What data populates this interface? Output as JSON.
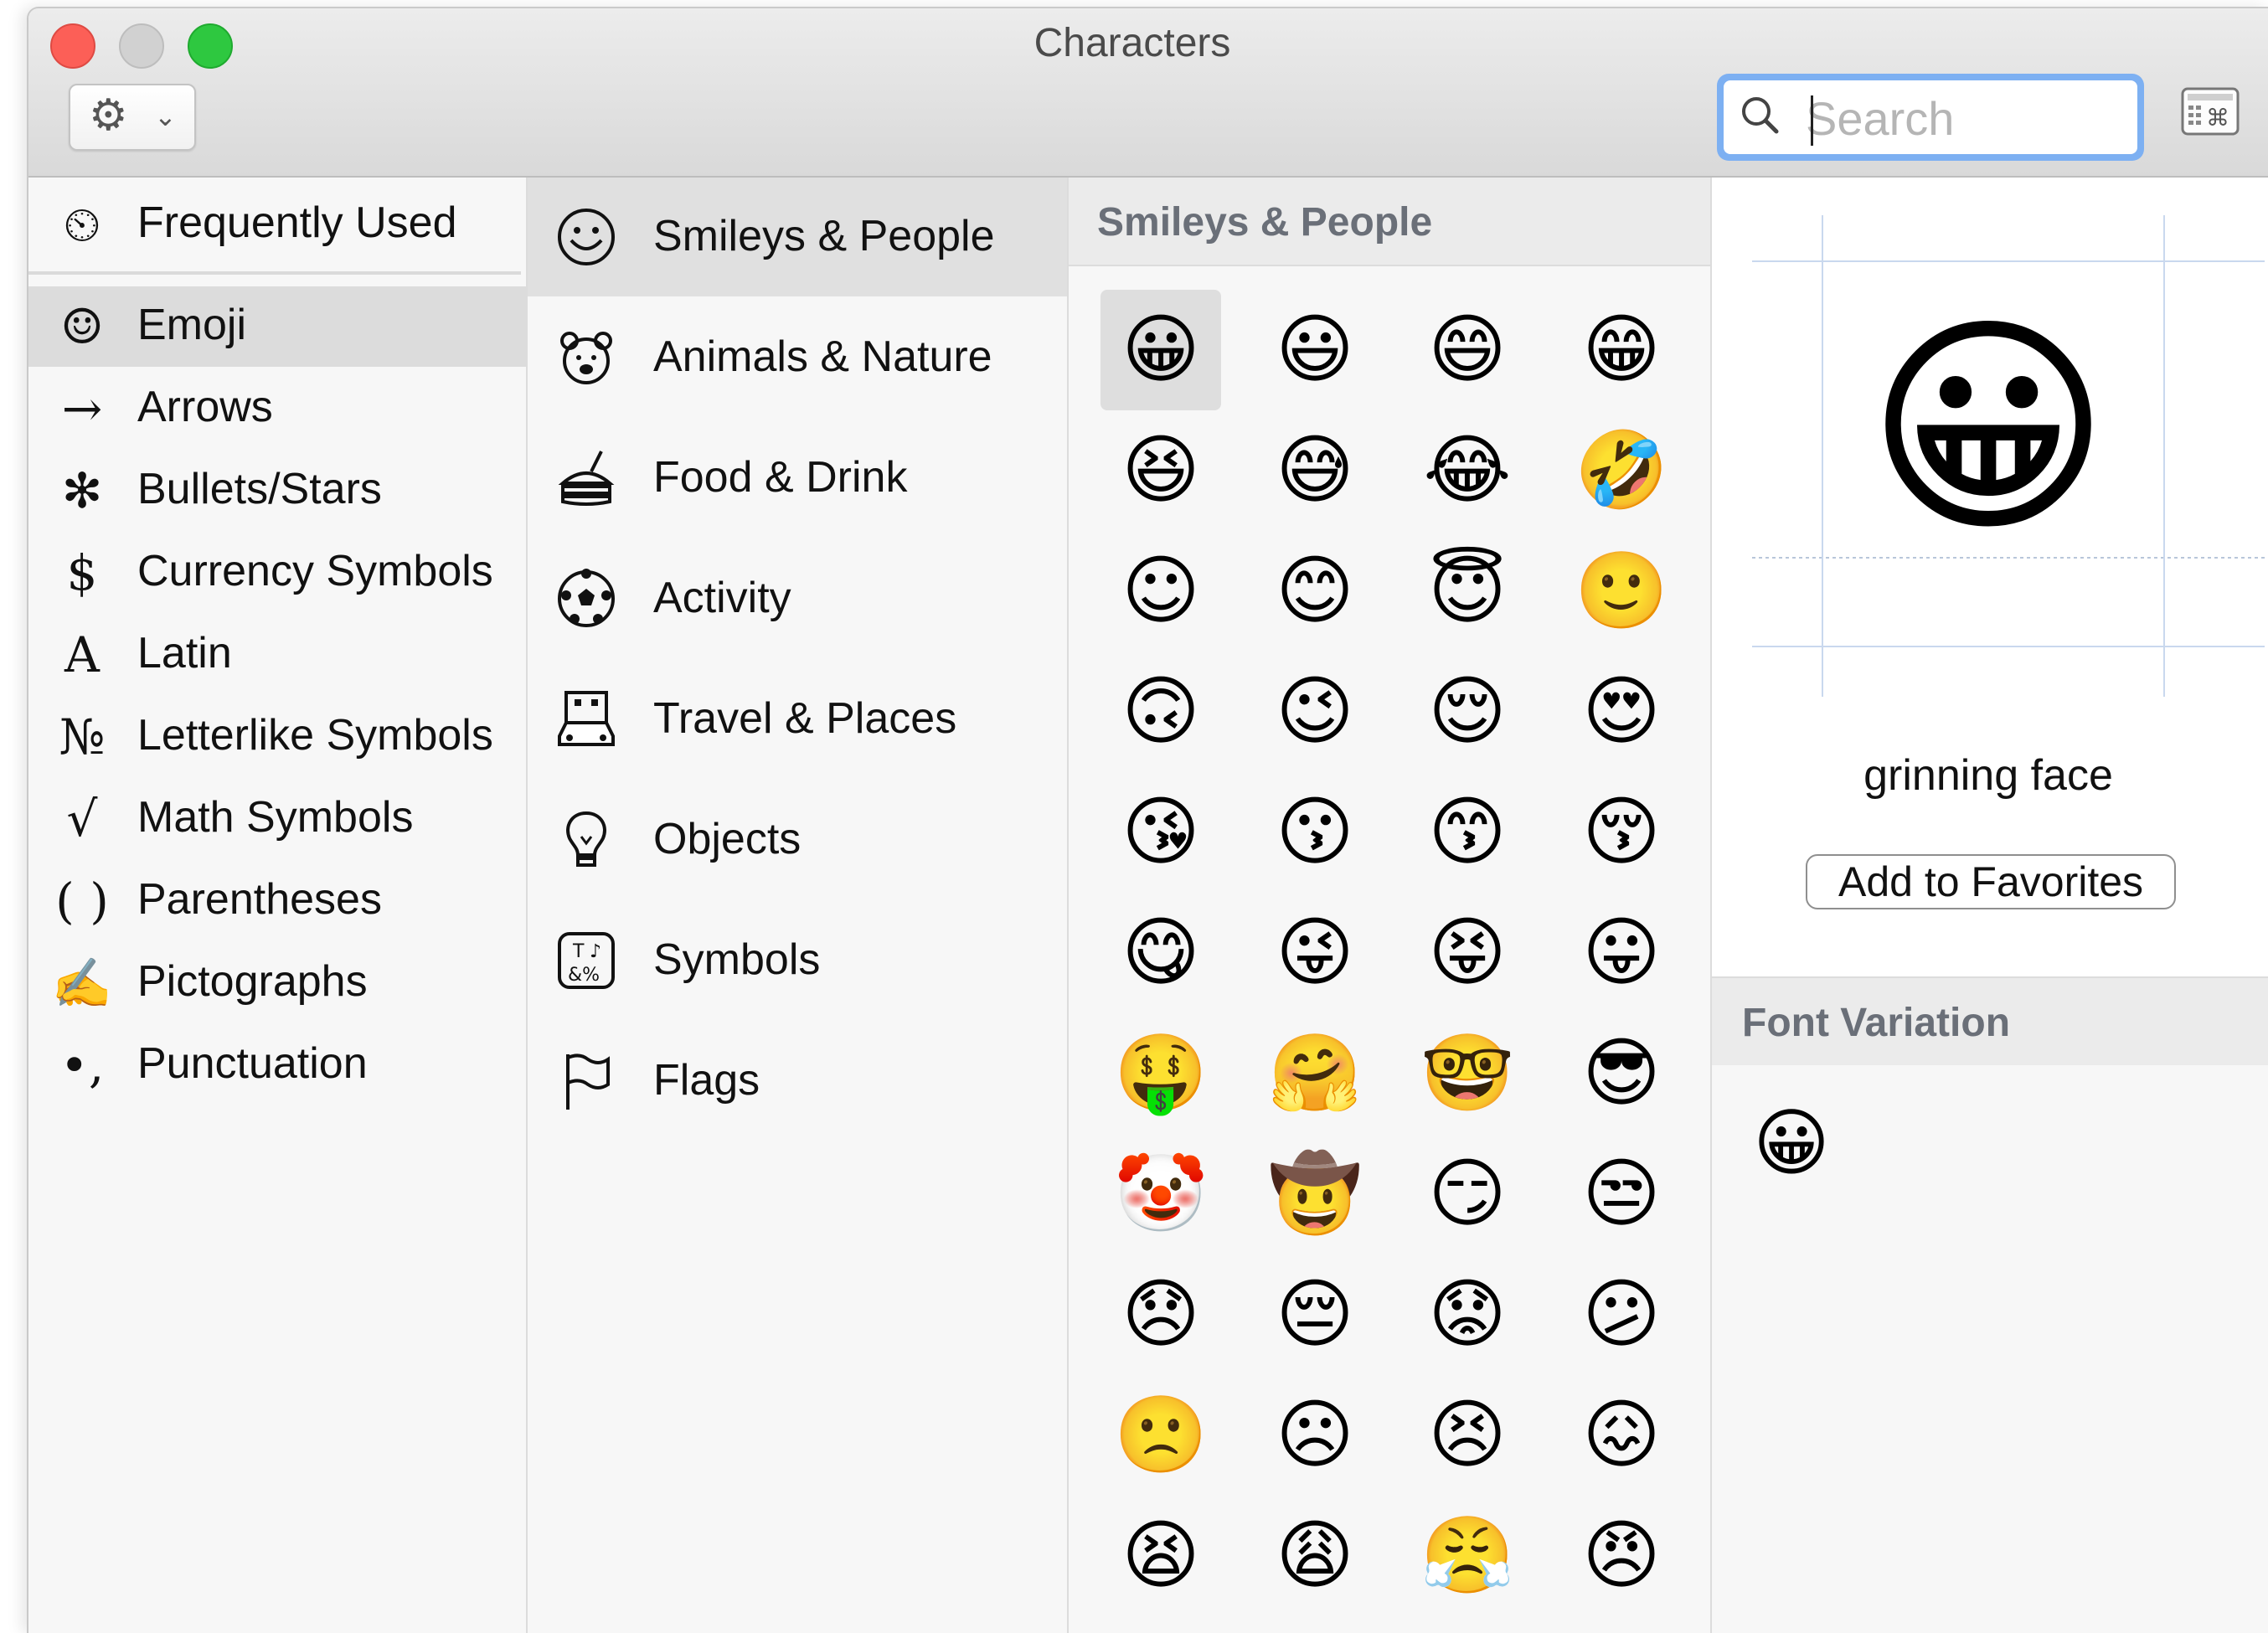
{
  "window": {
    "title": "Characters"
  },
  "toolbar": {
    "gear_icon": "gear-icon",
    "search_placeholder": "Search",
    "search_value": ""
  },
  "categories": [
    {
      "label": "Frequently Used",
      "icon": "⏲"
    },
    {
      "label": "Emoji",
      "icon": "☺"
    },
    {
      "label": "Arrows",
      "icon": "→"
    },
    {
      "label": "Bullets/Stars",
      "icon": "✻"
    },
    {
      "label": "Currency Symbols",
      "icon": "$"
    },
    {
      "label": "Latin",
      "icon": "A"
    },
    {
      "label": "Letterlike Symbols",
      "icon": "№"
    },
    {
      "label": "Math Symbols",
      "icon": "√"
    },
    {
      "label": "Parentheses",
      "icon": "( )"
    },
    {
      "label": "Pictographs",
      "icon": "✍"
    },
    {
      "label": "Punctuation",
      "icon": "•,"
    }
  ],
  "selected_category": "Emoji",
  "subcategories": [
    {
      "label": "Smileys & People"
    },
    {
      "label": "Animals & Nature"
    },
    {
      "label": "Food & Drink"
    },
    {
      "label": "Activity"
    },
    {
      "label": "Travel & Places"
    },
    {
      "label": "Objects"
    },
    {
      "label": "Symbols"
    },
    {
      "label": "Flags"
    }
  ],
  "selected_subcategory": "Smileys & People",
  "grid": {
    "header": "Smileys & People",
    "emojis": [
      "😀",
      "😃",
      "😄",
      "😁",
      "😆",
      "😅",
      "😂",
      "🤣",
      "☺",
      "😊",
      "😇",
      "🙂",
      "🙃",
      "😉",
      "😌",
      "😍",
      "😘",
      "😗",
      "😙",
      "😚",
      "😋",
      "😜",
      "😝",
      "😛",
      "🤑",
      "🤗",
      "🤓",
      "😎",
      "🤡",
      "🤠",
      "😏",
      "😒",
      "😞",
      "😔",
      "😟",
      "😕",
      "🙁",
      "☹",
      "😣",
      "😖",
      "😫",
      "😩",
      "😤",
      "😠"
    ],
    "selected_index": 0
  },
  "detail": {
    "character": "😀",
    "name": "grinning face",
    "add_button": "Add to Favorites",
    "variation_header": "Font Variation",
    "variations": [
      "😀"
    ]
  }
}
